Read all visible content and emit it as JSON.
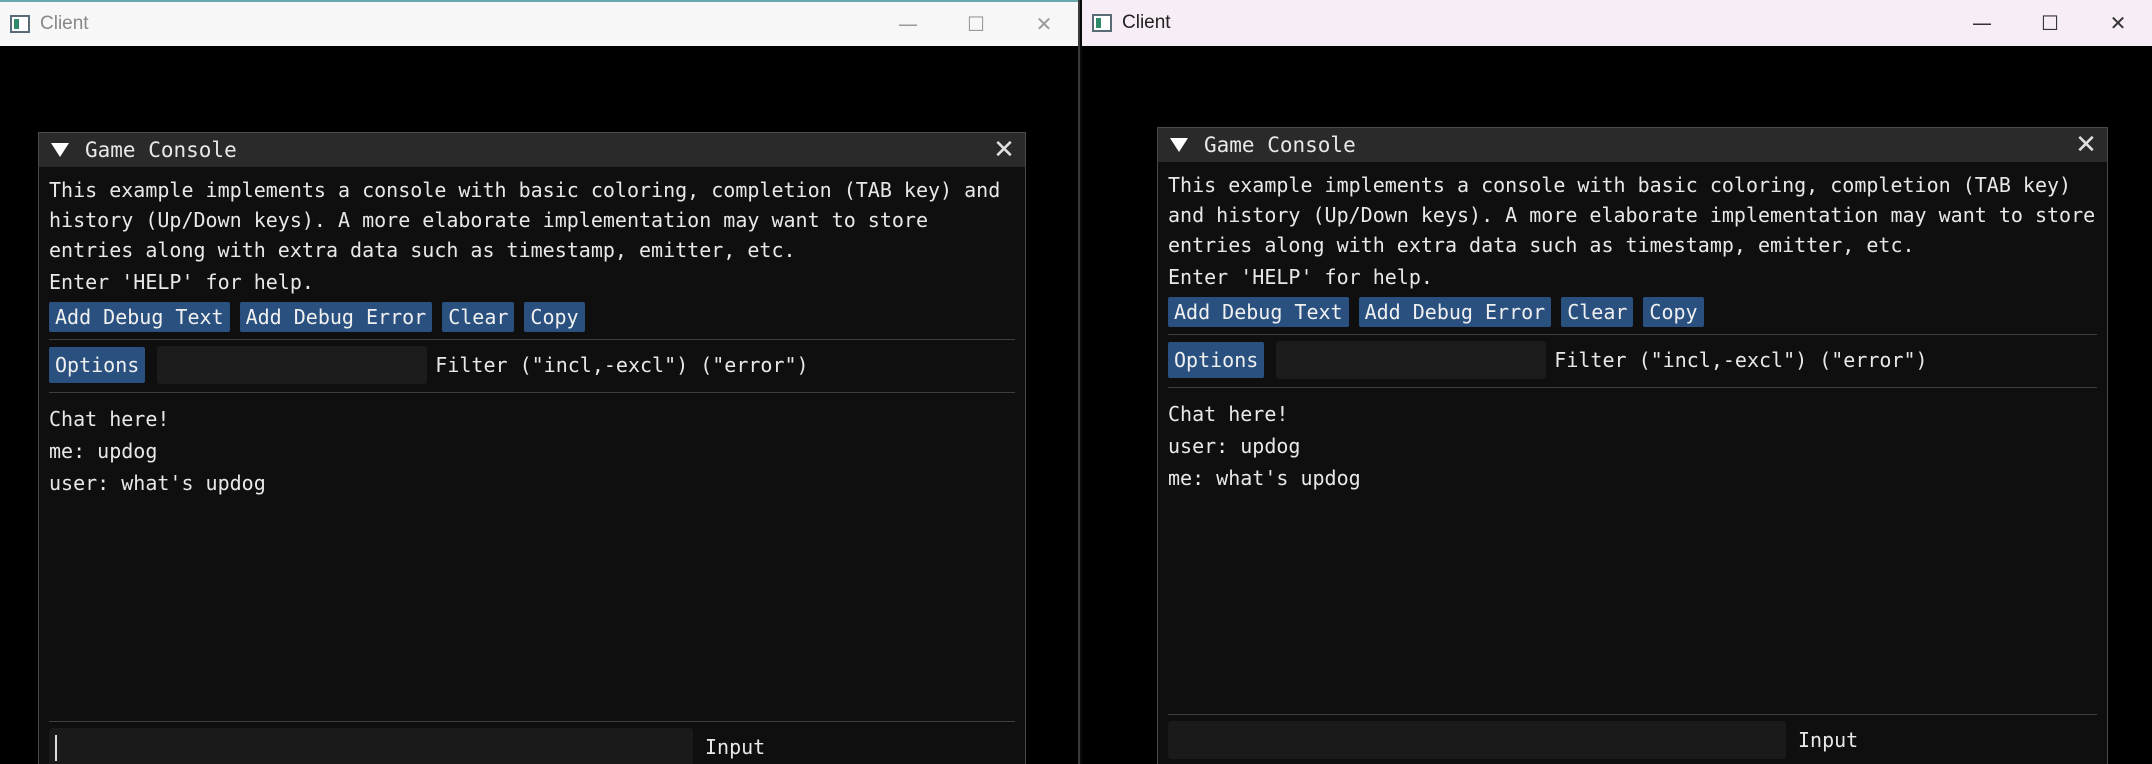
{
  "windows": [
    {
      "id": "left",
      "title": "Client",
      "controls": {
        "minimize": "—",
        "maximize": "☐",
        "close": "✕"
      },
      "console": {
        "title": "Game Console",
        "description": "This example implements a console with basic coloring, completion (TAB key) and\nhistory (Up/Down keys). A more elaborate implementation may want to store\nentries along with extra data such as timestamp, emitter, etc.",
        "help": "Enter 'HELP' for help.",
        "buttons": [
          "Add Debug Text",
          "Add Debug Error",
          "Clear",
          "Copy"
        ],
        "options_label": "Options",
        "filter_label": "Filter (\"incl,-excl\") (\"error\")",
        "log": [
          "Chat here!",
          "me: updog",
          "user: what's updog"
        ],
        "input_label": "Input"
      }
    },
    {
      "id": "right",
      "title": "Client",
      "controls": {
        "minimize": "—",
        "maximize": "☐",
        "close": "✕"
      },
      "console": {
        "title": "Game Console",
        "description": "This example implements a console with basic coloring, completion (TAB key)\nand history (Up/Down keys). A more elaborate implementation may want to store\nentries along with extra data such as timestamp, emitter, etc.",
        "help": "Enter 'HELP' for help.",
        "buttons": [
          "Add Debug Text",
          "Add Debug Error",
          "Clear",
          "Copy"
        ],
        "options_label": "Options",
        "filter_label": "Filter (\"incl,-excl\") (\"error\")",
        "log": [
          "Chat here!",
          "user: updog",
          "me: what's updog"
        ],
        "input_label": "Input"
      }
    }
  ],
  "colors": {
    "button": "#29507f",
    "window_bg": "#0f0f0f",
    "titlebar_bg": "#2a2a2a"
  }
}
